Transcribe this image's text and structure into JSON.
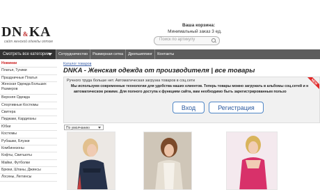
{
  "logo": {
    "main_left": "DN",
    "amp": "&",
    "main_right": "KA",
    "tagline": "сайт женской одежды оптом"
  },
  "cart": {
    "title": "Ваша корзина:",
    "min_order": "Минимальный заказ 3 ед."
  },
  "search": {
    "placeholder": "Поиск по артикулу"
  },
  "catalog_header": "Смотреть все категории",
  "nav": [
    "Сотрудничество",
    "Размерная сетка",
    "Дропшиппинг",
    "Контакты"
  ],
  "sidebar": [
    "Новинки",
    "Платья, Туники",
    "Праздничные Платья",
    "Женская Одежда Больших Размеров",
    "Верхняя Одежда",
    "Спортивные Костюмы",
    "Свитера",
    "Пиджаки, Кардиганы",
    "Юбки",
    "Костюмы",
    "Рубашки, Блузки",
    "Комбинезоны",
    "Кофты, Свитшоты",
    "Майки, Футболки",
    "Брюки, Штаны, Джинсы",
    "Лосины, Леггинсы"
  ],
  "breadcrumb": "Каталог товаров",
  "page_title": "DNKA - Женская одежда от производителя | все товары",
  "notice": {
    "line1": "Ручного труда больше нет. Автоматическая загрузка товаров в соц.сети",
    "line2": "Мы используем современные технологии для удобства наших клиентов. Теперь товары можно загружать в альбомы соц.сетей и н",
    "line3": "автоматическом режиме. Для полного доступа к функциям сайта, вам необходимо быть зарегистрированным пользо",
    "login": "Вход",
    "register": "Регистрация",
    "badge": "NEW"
  },
  "sort": {
    "selected": "По умолчанию"
  },
  "colors": {
    "accent_red": "#cc1e1e",
    "nav_bg": "#5d5d5d",
    "button_blue": "#4f86c6"
  }
}
